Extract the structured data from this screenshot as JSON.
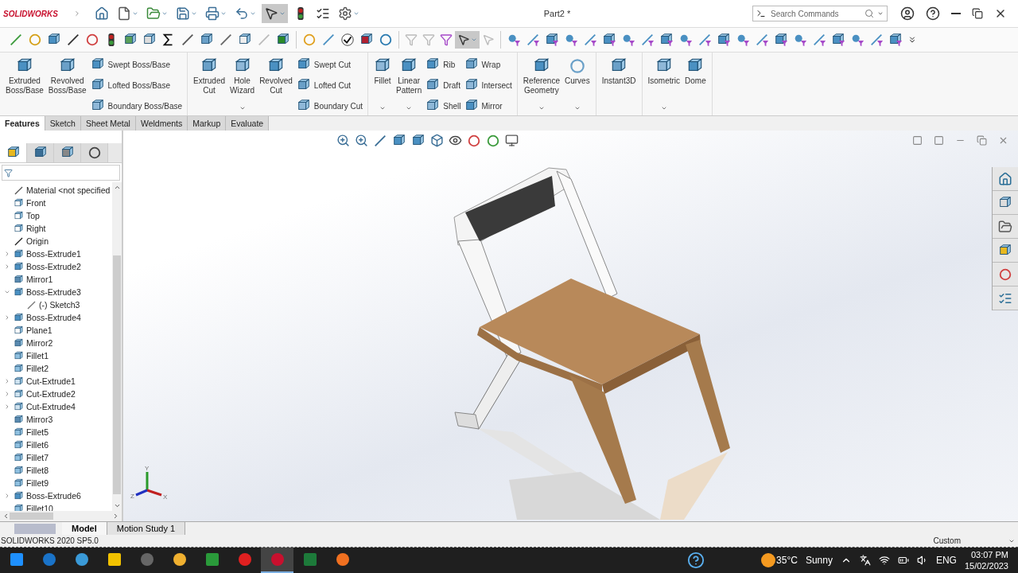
{
  "app": {
    "logo": "SOLIDWORKS",
    "title": "Part2 *"
  },
  "search": {
    "placeholder": "Search Commands"
  },
  "command_groups": [
    {
      "large": [
        {
          "label": "Extruded Boss/Base",
          "dropdown": false
        },
        {
          "label": "Revolved Boss/Base",
          "dropdown": false
        }
      ],
      "small": [
        [
          "Swept Boss/Base",
          "Lofted Boss/Base",
          "Boundary Boss/Base"
        ]
      ]
    },
    {
      "large": [
        {
          "label": "Extruded Cut",
          "dropdown": false
        },
        {
          "label": "Hole Wizard",
          "dropdown": true
        },
        {
          "label": "Revolved Cut",
          "dropdown": false
        }
      ],
      "small": [
        [
          "Swept Cut",
          "Lofted Cut",
          "Boundary Cut"
        ]
      ]
    },
    {
      "large": [
        {
          "label": "Fillet",
          "dropdown": true
        },
        {
          "label": "Linear Pattern",
          "dropdown": true
        }
      ],
      "small": [
        [
          "Rib",
          "Draft",
          "Shell"
        ],
        [
          "Wrap",
          "Intersect",
          "Mirror"
        ]
      ]
    },
    {
      "large": [
        {
          "label": "Reference Geometry",
          "dropdown": true
        },
        {
          "label": "Curves",
          "dropdown": true
        }
      ]
    },
    {
      "large": [
        {
          "label": "Instant3D",
          "dropdown": false
        }
      ]
    },
    {
      "large": [
        {
          "label": "Isometric",
          "dropdown": true
        },
        {
          "label": "Dome",
          "dropdown": false
        }
      ]
    }
  ],
  "tabs": [
    {
      "label": "Features",
      "selected": true
    },
    {
      "label": "Sketch",
      "selected": false
    },
    {
      "label": "Sheet Metal",
      "selected": false
    },
    {
      "label": "Weldments",
      "selected": false
    },
    {
      "label": "Markup",
      "selected": false
    },
    {
      "label": "Evaluate",
      "selected": false
    }
  ],
  "panel_tabs": [
    {
      "selected": true
    },
    {
      "selected": false
    },
    {
      "selected": false
    },
    {
      "selected": false
    }
  ],
  "tree": {
    "items": [
      {
        "label": "Material <not specified",
        "kind": "material"
      },
      {
        "label": "Front",
        "kind": "plane"
      },
      {
        "label": "Top",
        "kind": "plane"
      },
      {
        "label": "Right",
        "kind": "plane"
      },
      {
        "label": "Origin",
        "kind": "origin"
      },
      {
        "label": "Boss-Extrude1",
        "kind": "extrude",
        "expanded": false
      },
      {
        "label": "Boss-Extrude2",
        "kind": "extrude",
        "expanded": false
      },
      {
        "label": "Mirror1",
        "kind": "mirror"
      },
      {
        "label": "Boss-Extrude3",
        "kind": "extrude",
        "expanded": true,
        "children": [
          {
            "label": "(-) Sketch3",
            "kind": "sketch"
          }
        ]
      },
      {
        "label": "Boss-Extrude4",
        "kind": "extrude",
        "expanded": false
      },
      {
        "label": "Plane1",
        "kind": "plane"
      },
      {
        "label": "Mirror2",
        "kind": "mirror"
      },
      {
        "label": "Fillet1",
        "kind": "fillet"
      },
      {
        "label": "Fillet2",
        "kind": "fillet"
      },
      {
        "label": "Cut-Extrude1",
        "kind": "cut",
        "expanded": false
      },
      {
        "label": "Cut-Extrude2",
        "kind": "cut",
        "expanded": false
      },
      {
        "label": "Cut-Extrude4",
        "kind": "cut",
        "expanded": false
      },
      {
        "label": "Mirror3",
        "kind": "mirror"
      },
      {
        "label": "Fillet5",
        "kind": "fillet"
      },
      {
        "label": "Fillet6",
        "kind": "fillet"
      },
      {
        "label": "Fillet7",
        "kind": "fillet"
      },
      {
        "label": "Fillet8",
        "kind": "fillet"
      },
      {
        "label": "Fillet9",
        "kind": "fillet"
      },
      {
        "label": "Boss-Extrude6",
        "kind": "extrude",
        "expanded": false
      },
      {
        "label": "Fillet10",
        "kind": "fillet"
      }
    ]
  },
  "triad": {
    "y": "Y",
    "z": "Z",
    "x": "X"
  },
  "bottom_tabs": [
    {
      "label": "Model",
      "selected": true
    },
    {
      "label": "Motion Study 1",
      "selected": false
    }
  ],
  "status_bar": {
    "version": "SOLIDWORKS 2020 SP5.0",
    "units": "Custom"
  },
  "taskbar": {
    "apps": [
      {
        "selected": false
      },
      {
        "selected": false
      },
      {
        "selected": false
      },
      {
        "selected": false
      },
      {
        "selected": false
      },
      {
        "selected": false
      },
      {
        "selected": false
      },
      {
        "selected": false
      },
      {
        "selected": true
      },
      {
        "selected": false
      },
      {
        "selected": false
      }
    ],
    "weather": {
      "temperature": "35°C",
      "condition": "Sunny"
    },
    "language": "ENG",
    "time": "03:07 PM",
    "date": "15/02/2023"
  }
}
